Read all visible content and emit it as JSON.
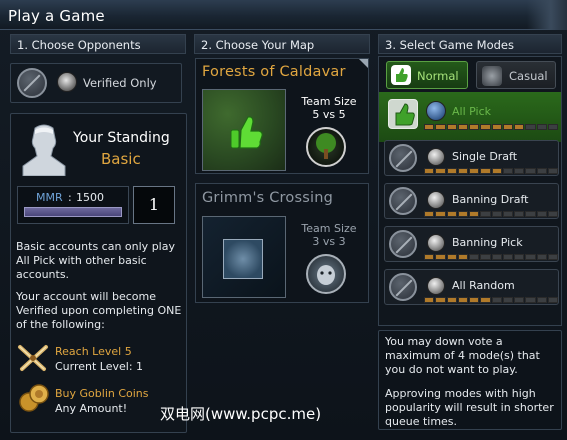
{
  "window": {
    "title": "Play a Game"
  },
  "columns": {
    "opponents": "1. Choose Opponents",
    "map": "2. Choose Your Map",
    "modes": "3. Select Game Modes"
  },
  "opponents": {
    "verified_only_label": "Verified Only"
  },
  "standing": {
    "title": "Your Standing",
    "tier": "Basic",
    "mmr_label": "MMR",
    "mmr_sep": ":",
    "mmr_value": "1500",
    "rank_number": "1",
    "basic_info": "Basic accounts can only play All Pick with other basic accounts.",
    "verify_info": "Your account will become Verified upon completing ONE of the following:",
    "reach_level_title": "Reach Level  5",
    "current_level": "Current Level:  1",
    "goblin_title": "Buy Goblin Coins",
    "goblin_sub": "Any Amount!"
  },
  "maps": [
    {
      "name": "Forests of Caldavar",
      "team_size_label": "Team Size",
      "team_size": "5 vs 5",
      "selected": true
    },
    {
      "name": "Grimm's Crossing",
      "team_size_label": "Team Size",
      "team_size": "3 vs 3",
      "selected": false
    }
  ],
  "mode_tabs": [
    {
      "label": "Normal",
      "active": true
    },
    {
      "label": "Casual",
      "active": false
    }
  ],
  "modes": [
    {
      "label": "All Pick",
      "approved": true,
      "popularity": 9,
      "popularity_max": 12
    },
    {
      "label": "Single Draft",
      "approved": false,
      "popularity": 7,
      "popularity_max": 12
    },
    {
      "label": "Banning Draft",
      "approved": false,
      "popularity": 5,
      "popularity_max": 12
    },
    {
      "label": "Banning Pick",
      "approved": false,
      "popularity": 4,
      "popularity_max": 12
    },
    {
      "label": "All Random",
      "approved": false,
      "popularity": 6,
      "popularity_max": 12
    }
  ],
  "tips": {
    "downvote": "You may down vote a maximum of 4 mode(s) that you do not want to play.",
    "approve": "Approving modes with high popularity will result in shorter queue times."
  },
  "watermark": "双电网(www.pcpc.me)",
  "colors": {
    "accent_gold": "#e0a640",
    "mmr_blue": "#6fa3d8",
    "approved_green": "#3f8f2c",
    "popularity_on": "#b07a2a"
  }
}
